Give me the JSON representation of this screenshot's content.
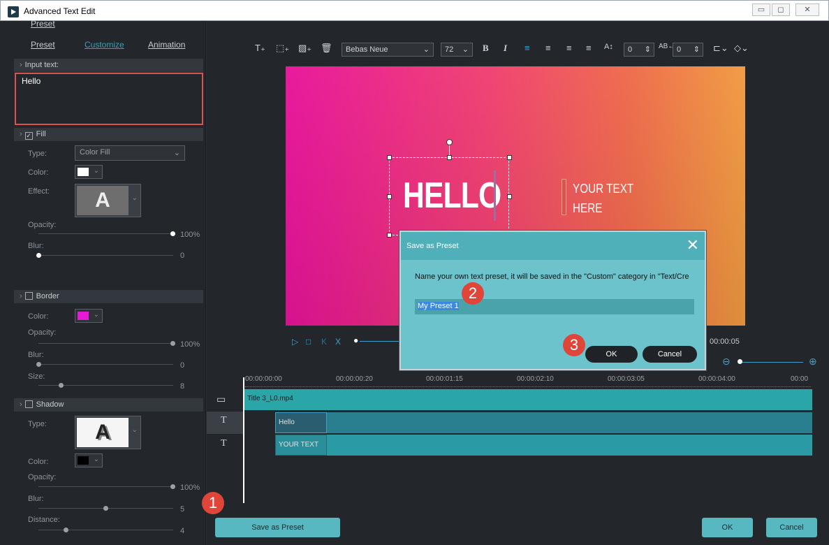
{
  "window": {
    "title": "Advanced Text Edit"
  },
  "tabs": {
    "preset": "Preset",
    "customize": "Customize",
    "animation": "Animation"
  },
  "input": {
    "label": "Input text:",
    "value": "Hello"
  },
  "fill": {
    "header": "Fill",
    "checked": true,
    "type_label": "Type:",
    "type_value": "Color Fill",
    "color_label": "Color:",
    "effect_label": "Effect:",
    "effect_letter": "A",
    "opacity_label": "Opacity:",
    "opacity_value": "100%",
    "blur_label": "Blur:",
    "blur_value": "0"
  },
  "border": {
    "header": "Border",
    "checked": false,
    "color_label": "Color:",
    "opacity_label": "Opacity:",
    "opacity_value": "100%",
    "blur_label": "Blur:",
    "blur_value": "0",
    "size_label": "Size:",
    "size_value": "8"
  },
  "shadow": {
    "header": "Shadow",
    "checked": false,
    "type_label": "Type:",
    "effect_letter": "A",
    "color_label": "Color:",
    "opacity_label": "Opacity:",
    "opacity_value": "100%",
    "blur_label": "Blur:",
    "blur_value": "5",
    "distance_label": "Distance:",
    "distance_value": "4"
  },
  "toolbar": {
    "font": "Bebas Neue",
    "size": "72",
    "line_spacing": "0",
    "char_spacing": "0"
  },
  "canvas": {
    "main_text": "HELLO",
    "secondary_line1": "YOUR TEXT",
    "secondary_line2": "HERE"
  },
  "player": {
    "time": "00:00:05"
  },
  "ruler": [
    "00:00:00:00",
    "00:00:00:20",
    "00:00:01:15",
    "00:00:02:10",
    "00:00:03:05",
    "00:00:04:00",
    "00:00"
  ],
  "tracks": {
    "video": "Title 3_L0.mp4",
    "t1": "Hello",
    "t2": "YOUR TEXT"
  },
  "dialog": {
    "title": "Save as Preset",
    "message": "Name your own text preset, it will be saved in the \"Custom\" category in \"Text/Cre",
    "input": "My Preset 1",
    "ok": "OK",
    "cancel": "Cancel"
  },
  "badges": {
    "b1": "1",
    "b2": "2",
    "b3": "3"
  },
  "footer": {
    "save_preset": "Save as Preset",
    "ok": "OK",
    "cancel": "Cancel"
  },
  "colors": {
    "fill": "#ffffff",
    "border": "#e81ad8",
    "shadow": "#000000",
    "accent": "#57b8c2",
    "badge": "#e0453a"
  }
}
